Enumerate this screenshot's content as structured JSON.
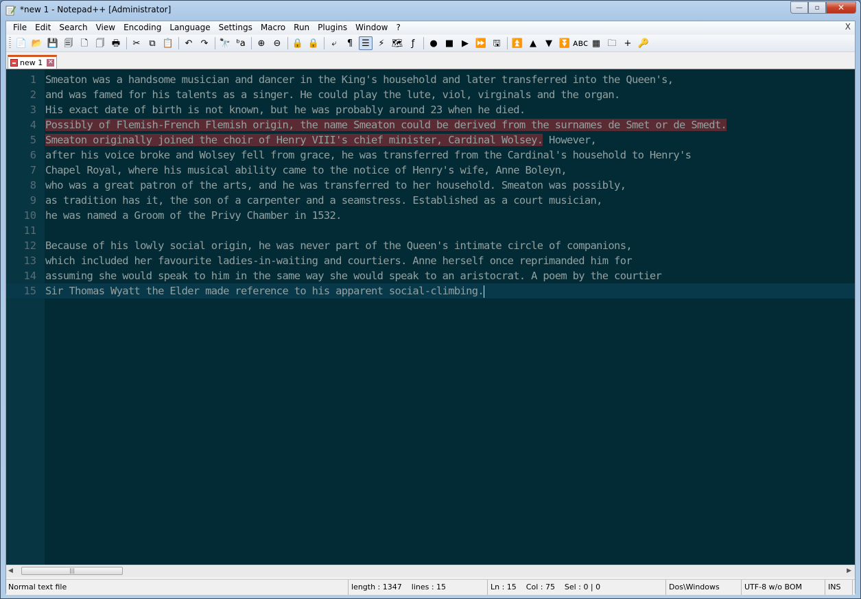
{
  "window": {
    "title": "*new  1 - Notepad++ [Administrator]",
    "controls": {
      "minimize": "—",
      "maximize": "▫",
      "close": "✕"
    }
  },
  "menubar": {
    "items": [
      {
        "label": "File"
      },
      {
        "label": "Edit"
      },
      {
        "label": "Search"
      },
      {
        "label": "View"
      },
      {
        "label": "Encoding"
      },
      {
        "label": "Language"
      },
      {
        "label": "Settings"
      },
      {
        "label": "Macro"
      },
      {
        "label": "Run"
      },
      {
        "label": "Plugins"
      },
      {
        "label": "Window"
      },
      {
        "label": "?"
      }
    ],
    "close_doc": "X"
  },
  "toolbar": {
    "buttons": [
      {
        "icon": "new-file-icon",
        "glyph": "📄"
      },
      {
        "icon": "open-file-icon",
        "glyph": "📂"
      },
      {
        "icon": "save-icon",
        "glyph": "💾"
      },
      {
        "icon": "save-all-icon",
        "glyph": "🗐"
      },
      {
        "icon": "close-icon",
        "glyph": "🗋"
      },
      {
        "icon": "close-all-icon",
        "glyph": "🗍"
      },
      {
        "icon": "print-icon",
        "glyph": "🖶"
      },
      {
        "sep": true
      },
      {
        "icon": "cut-icon",
        "glyph": "✂"
      },
      {
        "icon": "copy-icon",
        "glyph": "⧉"
      },
      {
        "icon": "paste-icon",
        "glyph": "📋"
      },
      {
        "sep": true
      },
      {
        "icon": "undo-icon",
        "glyph": "↶"
      },
      {
        "icon": "redo-icon",
        "glyph": "↷"
      },
      {
        "sep": true
      },
      {
        "icon": "find-icon",
        "glyph": "🔭"
      },
      {
        "icon": "replace-icon",
        "glyph": "ᵇa"
      },
      {
        "sep": true
      },
      {
        "icon": "zoom-in-icon",
        "glyph": "⊕"
      },
      {
        "icon": "zoom-out-icon",
        "glyph": "⊖"
      },
      {
        "sep": true
      },
      {
        "icon": "sync-vertical-icon",
        "glyph": "🔒"
      },
      {
        "icon": "sync-horizontal-icon",
        "glyph": "🔒"
      },
      {
        "sep": true
      },
      {
        "icon": "word-wrap-icon",
        "glyph": "⤶"
      },
      {
        "icon": "show-all-chars-icon",
        "glyph": "¶"
      },
      {
        "icon": "indent-guide-icon",
        "glyph": "☰",
        "active": true
      },
      {
        "icon": "user-defined-language-icon",
        "glyph": "⚡"
      },
      {
        "icon": "document-map-icon",
        "glyph": "🗺"
      },
      {
        "icon": "function-list-icon",
        "glyph": "ƒ"
      },
      {
        "sep": true
      },
      {
        "icon": "record-macro-icon",
        "glyph": "●"
      },
      {
        "icon": "stop-record-icon",
        "glyph": "■"
      },
      {
        "icon": "playback-macro-icon",
        "glyph": "▶"
      },
      {
        "icon": "run-macro-multiple-icon",
        "glyph": "⏩"
      },
      {
        "icon": "save-macro-icon",
        "glyph": "🖫"
      },
      {
        "sep": true
      },
      {
        "icon": "first-icon",
        "glyph": "⏫"
      },
      {
        "icon": "up-icon",
        "glyph": "▲"
      },
      {
        "icon": "down-icon",
        "glyph": "▼"
      },
      {
        "icon": "last-icon",
        "glyph": "⏬"
      },
      {
        "icon": "spell-check-icon",
        "glyph": "ᴀʙᴄ"
      },
      {
        "icon": "plugin-grid-icon",
        "glyph": "▦"
      },
      {
        "icon": "folder-icon",
        "glyph": "🗀"
      },
      {
        "icon": "add-icon",
        "glyph": "+"
      },
      {
        "icon": "key-icon",
        "glyph": "🔑"
      }
    ]
  },
  "tabs": [
    {
      "label": "new  1",
      "active": true
    }
  ],
  "editor": {
    "lines": [
      {
        "n": "1",
        "text": "Smeaton was a handsome musician and dancer in the King's household and later transferred into the Queen's,"
      },
      {
        "n": "2",
        "text": "and was famed for his talents as a singer. He could play the lute, viol, virginals and the organ."
      },
      {
        "n": "3",
        "text": "His exact date of birth is not known, but he was probably around 23 when he died."
      },
      {
        "n": "4",
        "text": "Possibly of Flemish-French Flemish origin, the name Smeaton could be derived from the surnames de Smet or de Smedt.",
        "selected": "all"
      },
      {
        "n": "5",
        "sel_text": "Smeaton originally joined the choir of Henry VIII's chief minister, Cardinal Wolsey.",
        "text": " However,"
      },
      {
        "n": "6",
        "text": "after his voice broke and Wolsey fell from grace, he was transferred from the Cardinal's household to Henry's"
      },
      {
        "n": "7",
        "text": "Chapel Royal, where his musical ability came to the notice of Henry's wife, Anne Boleyn,"
      },
      {
        "n": "8",
        "text": "who was a great patron of the arts, and he was transferred to her household. Smeaton was possibly,"
      },
      {
        "n": "9",
        "text": "as tradition has it, the son of a carpenter and a seamstress. Established as a court musician,"
      },
      {
        "n": "10",
        "text": "he was named a Groom of the Privy Chamber in 1532."
      },
      {
        "n": "11",
        "text": ""
      },
      {
        "n": "12",
        "text": "Because of his lowly social origin, he was never part of the Queen's intimate circle of companions,"
      },
      {
        "n": "13",
        "text": "which included her favourite ladies-in-waiting and courtiers. Anne herself once reprimanded him for"
      },
      {
        "n": "14",
        "text": "assuming she would speak to him in the same way she would speak to an aristocrat. A poem by the courtier"
      },
      {
        "n": "15",
        "text": "Sir Thomas Wyatt the Elder made reference to his apparent social-climbing.",
        "current": true
      }
    ],
    "colors": {
      "background": "#022b36",
      "gutter": "#073642",
      "text": "#93a1a1",
      "selection": "#5b2b33",
      "line_numbers": "#586e75"
    }
  },
  "statusbar": {
    "file_type": "Normal text file",
    "length": "length : 1347",
    "lines": "lines : 15",
    "position": "Ln : 15    Col : 75    Sel : 0 | 0",
    "eol": "Dos\\Windows",
    "encoding": "UTF-8 w/o BOM",
    "mode": "INS"
  }
}
